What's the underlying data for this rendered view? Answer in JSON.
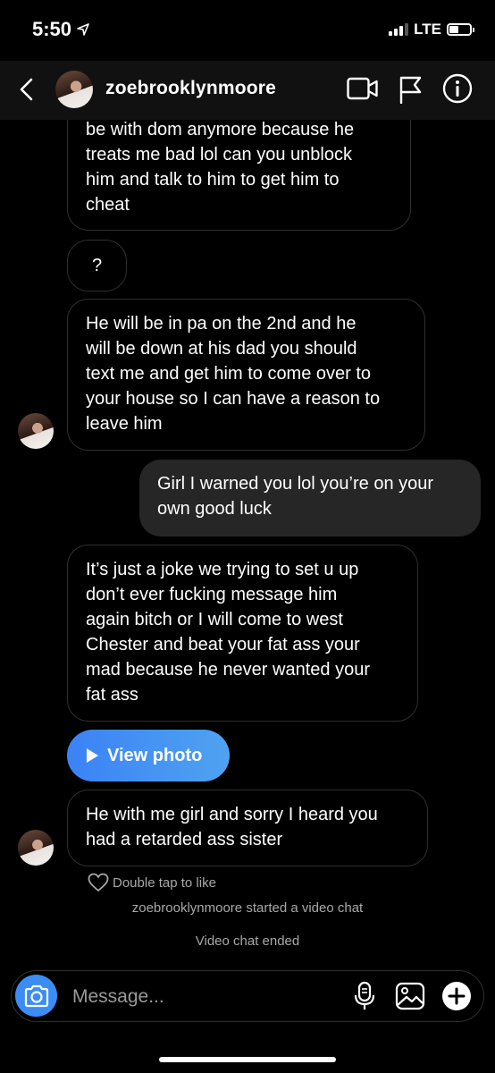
{
  "status_bar": {
    "time": "5:50",
    "carrier": "LTE",
    "battery_level": 0.45
  },
  "header": {
    "username": "zoebrooklynmoore",
    "icons": [
      "back-chevron-icon",
      "video-call-icon",
      "flag-icon",
      "info-icon"
    ]
  },
  "messages": [
    {
      "direction": "received",
      "text": "be with dom anymore because he\ntreats me bad lol can you unblock\nhim and talk to him to get him to\ncheat"
    },
    {
      "direction": "received",
      "text": "?"
    },
    {
      "direction": "received",
      "text": "He will be in pa on the 2nd and he\nwill be down at his dad you should\ntext me and get him to come over to\nyour house so I can have a reason to\nleave him"
    },
    {
      "direction": "sent",
      "text": "Girl I warned you lol you’re on your\nown good luck"
    },
    {
      "direction": "received",
      "text": "It’s just a joke we trying to set u up\ndon’t ever fucking message him\nagain bitch or I will come to west\nChester and beat your fat ass your\nmad because he never wanted your\nfat ass"
    },
    {
      "direction": "received",
      "type": "photo",
      "text": "View photo"
    },
    {
      "direction": "received",
      "text": "He with me girl and sorry I heard you\nhad a retarded ass sister"
    }
  ],
  "like_hint": "Double tap to like",
  "system_messages": [
    "zoebrooklynmoore started a video chat",
    "Video chat ended"
  ],
  "composer": {
    "placeholder": "Message...",
    "icons": [
      "camera-icon",
      "microphone-icon",
      "gallery-icon",
      "plus-icon"
    ]
  },
  "colors": {
    "background": "#000000",
    "sent_bubble": "#262626",
    "received_border": "#2f2f2f",
    "accent_blue": "#3b8df5",
    "secondary_text": "#a8a8a8"
  }
}
